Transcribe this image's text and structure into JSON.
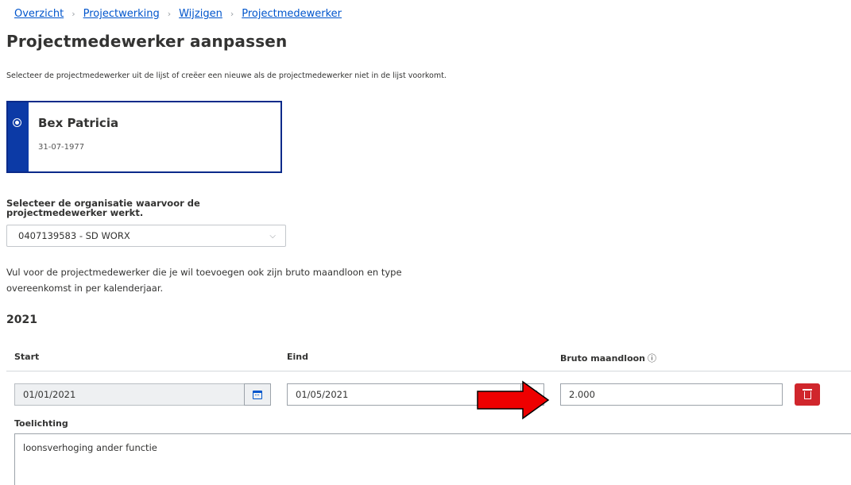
{
  "breadcrumb": [
    "Overzicht",
    "Projectwerking",
    "Wijzigen",
    "Projectmedewerker"
  ],
  "page_title": "Projectmedewerker aanpassen",
  "intro_text": "Selecteer de projectmedewerker uit de lijst of creëer een nieuwe als de projectmedewerker niet in de lijst voorkomt.",
  "person": {
    "name": "Bex Patricia",
    "birthdate": "31-07-1977",
    "selected": true
  },
  "organisation": {
    "label": "Selecteer de organisatie waarvoor de projectmedewerker werkt.",
    "value": "0407139583 - SD WORX"
  },
  "fill_text": "Vul voor de projectmedewerker die je wil toevoegen ook zijn bruto maandloon en type overeenkomst in per kalenderjaar.",
  "year": "2021",
  "table": {
    "headers": {
      "start": "Start",
      "end": "Eind",
      "salary": "Bruto maandloon",
      "info_icon": "ⓘ"
    },
    "row": {
      "start": "01/01/2021",
      "end": "01/05/2021",
      "salary": "2.000"
    }
  },
  "explanation": {
    "label": "Toelichting",
    "value": "loonsverhoging ander functie"
  },
  "colors": {
    "link": "#0055cc",
    "accent": "#0c3aa6",
    "danger": "#d0262c",
    "annotation_arrow": "#ee0000"
  }
}
